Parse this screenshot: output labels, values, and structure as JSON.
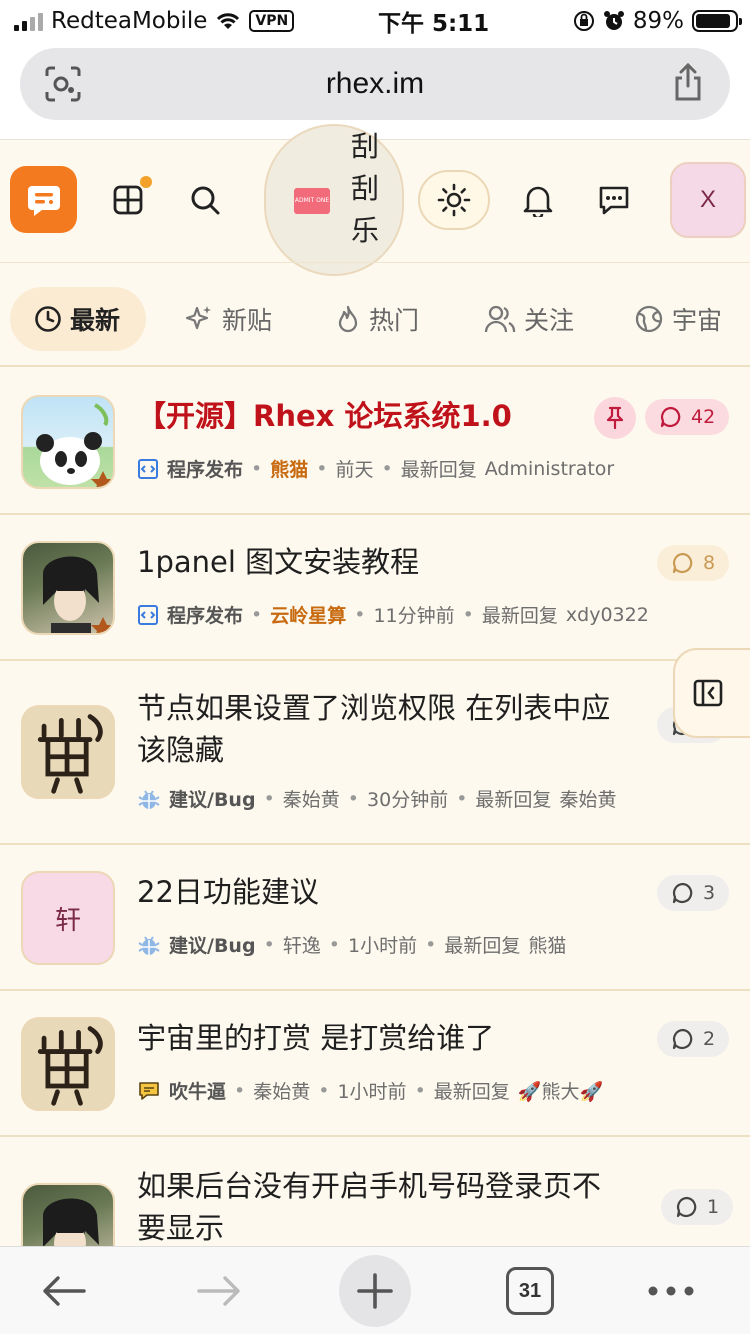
{
  "status_bar": {
    "carrier": "RedteaMobile",
    "vpn": "VPN",
    "time": "下午 5:11",
    "battery": "89%",
    "battery_level": 0.89
  },
  "url_bar": {
    "url": "rhex.im"
  },
  "header": {
    "scratch_label": [
      "刮",
      "刮",
      "乐"
    ],
    "ticket_text": "ADMIT ONE",
    "avatar_letter": "X"
  },
  "tabs": [
    {
      "label": "最新",
      "icon": "clock-icon",
      "active": true
    },
    {
      "label": "新贴",
      "icon": "sparkle-icon",
      "active": false
    },
    {
      "label": "热门",
      "icon": "flame-icon",
      "active": false
    },
    {
      "label": "关注",
      "icon": "users-icon",
      "active": false
    },
    {
      "label": "宇宙",
      "icon": "globe-icon",
      "active": false
    }
  ],
  "posts": [
    {
      "title": "【开源】Rhex 论坛系统1.0",
      "title_color": "#c0121a",
      "category": "程序发布",
      "author": "熊猫",
      "author_highlight": true,
      "time": "前天",
      "reply_label": "最新回复",
      "last_replier": "Administrator",
      "replies": "42",
      "pinned": true,
      "avatar": "panda-avatar"
    },
    {
      "title": "1panel 图文安装教程",
      "category": "程序发布",
      "author": "云岭星算",
      "author_highlight": true,
      "time": "11分钟前",
      "reply_label": "最新回复",
      "last_replier": "xdy0322",
      "replies": "8",
      "pinned": false,
      "avatar": "anime-avatar"
    },
    {
      "title_line1": "节点如果设置了浏览权限 在列表中应",
      "title_line2": "该隐藏",
      "category": "建议/Bug",
      "author": "秦始黄",
      "time": "30分钟前",
      "reply_label": "最新回复",
      "last_replier": "秦始黄",
      "avatar": "calligraphy-avatar"
    },
    {
      "title": "22日功能建议",
      "category": "建议/Bug",
      "author": "轩逸",
      "time": "1小时前",
      "reply_label": "最新回复",
      "last_replier": "熊猫",
      "replies": "3",
      "avatar_text": "轩"
    },
    {
      "title": "宇宙里的打赏 是打赏给谁了",
      "category": "吹牛逼",
      "author": "秦始黄",
      "time": "1小时前",
      "reply_label": "最新回复",
      "last_replier": "🚀熊大🚀",
      "replies": "2",
      "avatar": "calligraphy-avatar"
    },
    {
      "title_line1": "如果后台没有开启手机号码登录页不",
      "title_line2": "要显示",
      "replies": "1",
      "avatar": "anime-avatar"
    }
  ],
  "toolbar": {
    "tab_count": "31"
  },
  "colors": {
    "accent": "#f47a1f",
    "background": "#fdf9ee",
    "highlight_author": "#c86a10"
  }
}
